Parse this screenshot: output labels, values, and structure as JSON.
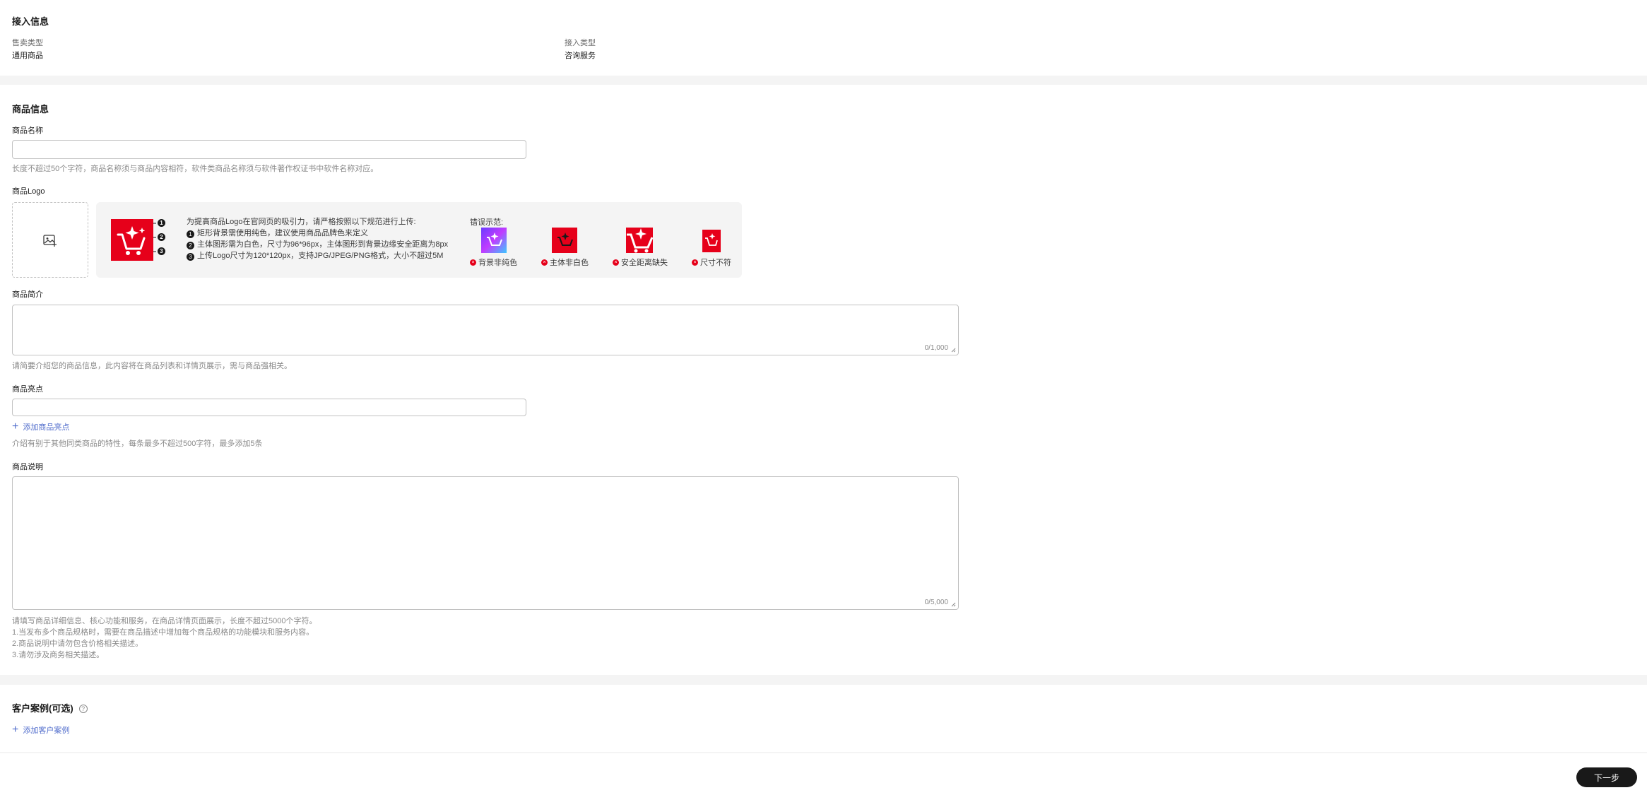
{
  "access_info": {
    "title": "接入信息",
    "sale_type_label": "售卖类型",
    "sale_type_value": "通用商品",
    "access_type_label": "接入类型",
    "access_type_value": "咨询服务"
  },
  "product_info": {
    "title": "商品信息",
    "name_label": "商品名称",
    "name_value": "",
    "name_hint": "长度不超过50个字符，商品名称须与商品内容相符，软件类商品名称须与软件著作权证书中软件名称对应。",
    "logo_label": "商品Logo",
    "logo_guide": {
      "intro": "为提高商品Logo在官网页的吸引力，请严格按照以下规范进行上传:",
      "rules": [
        {
          "n": "1",
          "text": "矩形背景需使用纯色，建议使用商品品牌色来定义"
        },
        {
          "n": "2",
          "text": "主体图形需为白色，尺寸为96*96px，主体图形到背景边缘安全距离为8px"
        },
        {
          "n": "3",
          "text": "上传Logo尺寸为120*120px，支持JPG/JPEG/PNG格式，大小不超过5M"
        }
      ],
      "error_title": "错误示范:",
      "errors": [
        "背景非纯色",
        "主体非白色",
        "安全距离缺失",
        "尺寸不符"
      ],
      "brand_color": "#e6001a"
    },
    "intro_label": "商品简介",
    "intro_counter": "0/1,000",
    "intro_hint": "请简要介绍您的商品信息，此内容将在商品列表和详情页展示，需与商品强相关。",
    "highlight_label": "商品亮点",
    "highlight_value": "",
    "add_highlight": "添加商品亮点",
    "highlight_hint": "介绍有别于其他同类商品的特性，每条最多不超过500字符，最多添加5条",
    "desc_label": "商品说明",
    "desc_counter": "0/5,000",
    "desc_hints": [
      "请填写商品详细信息、核心功能和服务，在商品详情页面展示，长度不超过5000个字符。",
      "1.当发布多个商品规格时，需要在商品描述中增加每个商品规格的功能模块和服务内容。",
      "2.商品说明中请勿包含价格相关描述。",
      "3.请勿涉及商务相关描述。"
    ]
  },
  "customer_cases": {
    "title": "客户案例(可选)",
    "add_case": "添加客户案例"
  },
  "footer": {
    "next_label": "下一步"
  }
}
